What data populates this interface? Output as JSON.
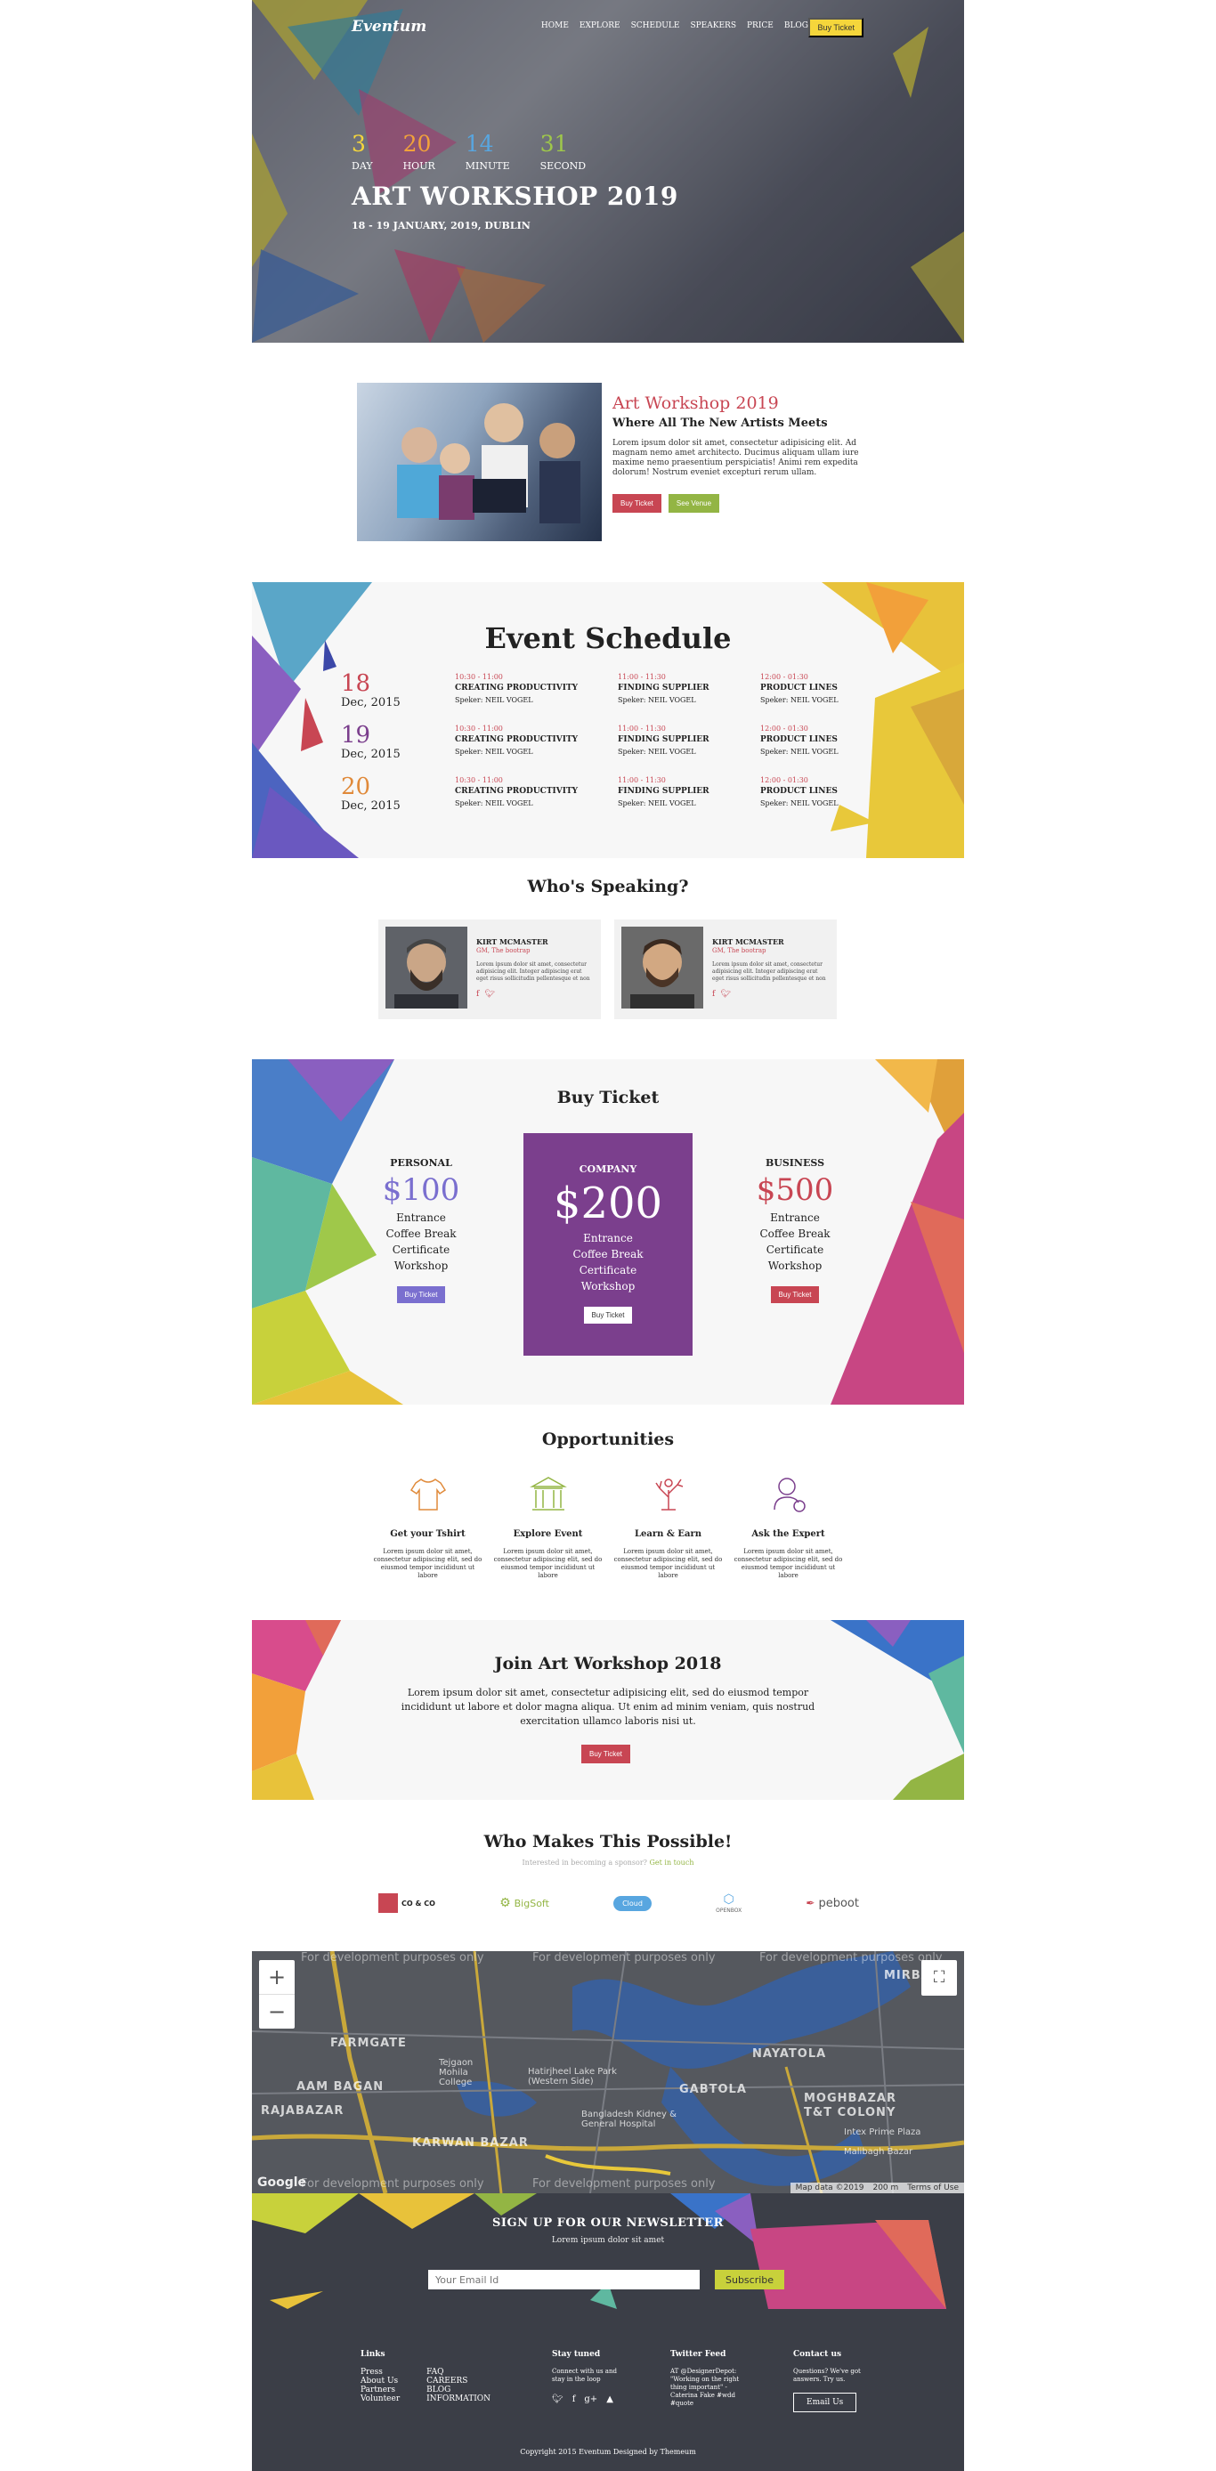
{
  "hero": {
    "brand": "Eventum",
    "nav": [
      "HOME",
      "EXPLORE",
      "SCHEDULE",
      "SPEAKERS",
      "PRICE",
      "BLOG"
    ],
    "nav_button": "Buy Ticket",
    "countdown": [
      {
        "value": "3",
        "label": "DAY",
        "color": "#f5d63b"
      },
      {
        "value": "20",
        "label": "HOUR",
        "color": "#f2a23a"
      },
      {
        "value": "14",
        "label": "MINUTE",
        "color": "#58a6e0"
      },
      {
        "value": "31",
        "label": "SECOND",
        "color": "#9fc84a"
      }
    ],
    "title": "ART WORKSHOP 2019",
    "subtitle": "18 - 19 JANUARY, 2019, DUBLIN"
  },
  "about": {
    "title": "Art Workshop 2019",
    "subtitle": "Where All The New Artists Meets",
    "body": "Lorem ipsum dolor sit amet, consectetur adipisicing elit. Ad magnam nemo amet architecto. Ducimus aliquam ullam iure maxime nemo praesentium perspiciatis! Animi rem expedita dolorum! Nostrum eveniet excepturi rerum ullam.",
    "buy_label": "Buy Ticket",
    "venue_label": "See Venue"
  },
  "schedule": {
    "title": "Event Schedule",
    "days": [
      {
        "day": "18",
        "month": "Dec, 2015",
        "color": "#c84653"
      },
      {
        "day": "19",
        "month": "Dec, 2015",
        "color": "#7b3f8d"
      },
      {
        "day": "20",
        "month": "Dec, 2015",
        "color": "#e08a3a"
      }
    ],
    "rows": [
      [
        {
          "time": "10:30 - 11:00",
          "name": "CREATING PRODUCTIVITY",
          "speaker": "Speker: NEIL VOGEL"
        },
        {
          "time": "11:00 - 11:30",
          "name": "FINDING SUPPLIER",
          "speaker": "Speker: NEIL VOGEL"
        },
        {
          "time": "12:00 - 01:30",
          "name": "PRODUCT LINES",
          "speaker": "Speker: NEIL VOGEL"
        }
      ],
      [
        {
          "time": "10:30 - 11:00",
          "name": "CREATING PRODUCTIVITY",
          "speaker": "Speker: NEIL VOGEL"
        },
        {
          "time": "11:00 - 11:30",
          "name": "FINDING SUPPLIER",
          "speaker": "Speker: NEIL VOGEL"
        },
        {
          "time": "12:00 - 01:30",
          "name": "PRODUCT LINES",
          "speaker": "Speker: NEIL VOGEL"
        }
      ],
      [
        {
          "time": "10:30 - 11:00",
          "name": "CREATING PRODUCTIVITY",
          "speaker": "Speker: NEIL VOGEL"
        },
        {
          "time": "11:00 - 11:30",
          "name": "FINDING SUPPLIER",
          "speaker": "Speker: NEIL VOGEL"
        },
        {
          "time": "12:00 - 01:30",
          "name": "PRODUCT LINES",
          "speaker": "Speker: NEIL VOGEL"
        }
      ]
    ]
  },
  "speakers": {
    "title": "Who's Speaking?",
    "items": [
      {
        "name": "KIRT MCMASTER",
        "role": "GM, The bootrap",
        "bio": "Lorem ipsum dolor sit amet, consectetur adipisicing elit. Integer adipiscing erat eget risus sollicitudin pellentesque et non"
      },
      {
        "name": "KIRT MCMASTER",
        "role": "GM, The bootrap",
        "bio": "Lorem ipsum dolor sit amet, consectetur adipisicing elit. Integer adipiscing erat eget risus sollicitudin pellentesque et non"
      }
    ]
  },
  "ticket": {
    "title": "Buy Ticket",
    "plans": [
      {
        "name": "PERSONAL",
        "price": "$100",
        "color": "#7a6fcf",
        "features": [
          "Entrance",
          "Coffee Break",
          "Certificate",
          "Workshop"
        ],
        "button": "Buy Ticket"
      },
      {
        "name": "COMPANY",
        "price": "$200",
        "color": "#7b3f8d",
        "features": [
          "Entrance",
          "Coffee Break",
          "Certificate",
          "Workshop"
        ],
        "button": "Buy Ticket"
      },
      {
        "name": "BUSINESS",
        "price": "$500",
        "color": "#c84653",
        "features": [
          "Entrance",
          "Coffee Break",
          "Certificate",
          "Workshop"
        ],
        "button": "Buy Ticket"
      }
    ]
  },
  "opportunities": {
    "title": "Opportunities",
    "items": [
      {
        "name": "Get your Tshirt",
        "text": "Lorem ipsum dolor sit amet, consectetur adipiscing elit, sed do eiusmod tempor incididunt ut labore",
        "color": "#e08a3a",
        "icon": "tshirt-icon"
      },
      {
        "name": "Explore Event",
        "text": "Lorem ipsum dolor sit amet, consectetur adipiscing elit, sed do eiusmod tempor incididunt ut labore",
        "color": "#93b544",
        "icon": "building-icon"
      },
      {
        "name": "Learn & Earn",
        "text": "Lorem ipsum dolor sit amet, consectetur adipiscing elit, sed do eiusmod tempor incididunt ut labore",
        "color": "#c84653",
        "icon": "tree-icon"
      },
      {
        "name": "Ask the Expert",
        "text": "Lorem ipsum dolor sit amet, consectetur adipiscing elit, sed do eiusmod tempor incididunt ut labore",
        "color": "#7b3f8d",
        "icon": "expert-icon"
      }
    ]
  },
  "join": {
    "title": "Join Art Workshop 2018",
    "body": "Lorem ipsum dolor sit amet, consectetur adipisicing elit, sed do eiusmod tempor incididunt ut labore et dolor magna aliqua. Ut enim ad minim veniam, quis nostrud exercitation ullamco laboris nisi ut.",
    "button": "Buy Ticket"
  },
  "sponsors": {
    "title": "Who Makes This Possible!",
    "sub_text": "Interested in becoming a sponsor?",
    "sub_link": "Get in touch",
    "logos": [
      "CO & CO",
      "BigSoft",
      "Cloud",
      "OPENBOX",
      "peboot"
    ]
  },
  "map": {
    "watermark": "For development purposes only",
    "areas": [
      "FARMGATE",
      "AAM BAGAN",
      "RAJABAZAR",
      "KARWAN BAZAR",
      "NAYATOLA",
      "GABTOLA",
      "MOGHBAZAR T&T COLONY",
      "MIRBA"
    ],
    "places": [
      "Tejgaon Mohila College",
      "Hatirjheel Lake Park (Western Side)",
      "Bangladesh Kidney & General Hospital",
      "Intex Prime Plaza",
      "Malibagh Bazar"
    ],
    "footer": [
      "Map data ©2019",
      "200 m",
      "Terms of Use"
    ],
    "google": "Google"
  },
  "newsletter": {
    "title": "SIGN UP FOR OUR NEWSLETTER",
    "subtitle": "Lorem ipsum dolor sit amet",
    "placeholder": "Your Email Id",
    "button": "Subscribe"
  },
  "footer": {
    "links_title": "Links",
    "links_a": [
      "Press",
      "About Us",
      "Partners",
      "Volunteer"
    ],
    "links_b": [
      "FAQ",
      "CAREERS",
      "BLOG",
      "INFORMATION"
    ],
    "stay_title": "Stay tuned",
    "stay_text": "Connect with us and stay in the loop",
    "twitter_title": "Twitter Feed",
    "twitter_text": "AT @DesignerDepot: \"Working on the right thing important\" -Caterina Fake #wdd #quote",
    "contact_title": "Contact us",
    "contact_text": "Questions? We've got answers. Try us.",
    "email_button": "Email Us",
    "copyright": "Copyright 2015 Eventum Designed by Themeum"
  }
}
